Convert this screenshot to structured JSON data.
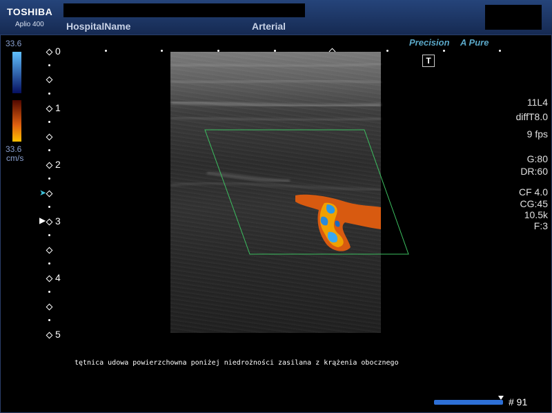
{
  "header": {
    "brand": "TOSHIBA",
    "model": "Aplio 400",
    "hospital": "HospitalName",
    "exam": "Arterial"
  },
  "velocity_scale": {
    "top": "33.6",
    "bottom": "33.6",
    "unit": "cm/s",
    "colors": {
      "positive_top": "#40a0ff",
      "positive_bottom": "#0a1a80",
      "negative_top": "#701000",
      "negative_bottom": "#ffb000"
    }
  },
  "depth_scale": {
    "labels": [
      "0",
      "1",
      "2",
      "3",
      "4",
      "5"
    ],
    "focus_marker_color": "#3ec0d8"
  },
  "badges": {
    "precision": "Precision",
    "pure_letter": "A",
    "pure": "Pure",
    "t_button": "T"
  },
  "params": {
    "probe": "11L4",
    "mode": "diffT8.0",
    "fps": "9 fps",
    "gain": "G:80",
    "dr": "DR:60",
    "cf": "CF 4.0",
    "cg": "CG:45",
    "prf": "10.5k",
    "filter": "F:3"
  },
  "caption": "tętnica udowa powierzchowna poniżej niedrożności zasilana z krążenia obocznego",
  "frame": {
    "label": "# 91"
  },
  "colors": {
    "header": "#1e3766",
    "roi_box": "#3cc060",
    "doppler_red": "#d85a10",
    "doppler_blue": "#2a8ad8"
  }
}
